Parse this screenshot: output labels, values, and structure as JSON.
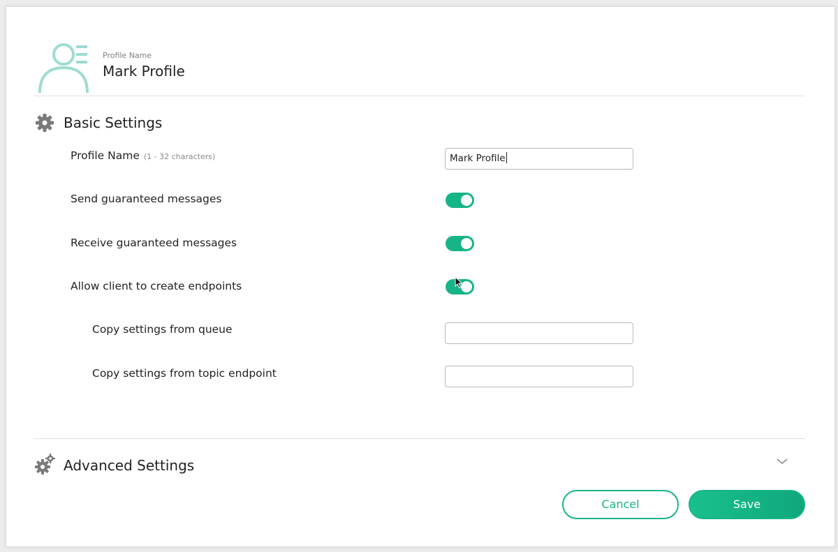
{
  "profile": {
    "caption": "Profile Name",
    "name": "Mark Profile"
  },
  "basic_settings": {
    "title": "Basic Settings",
    "rows": [
      {
        "label": "Profile Name",
        "hint": "(1 - 32 characters)",
        "value": "Mark Profile"
      },
      {
        "label": "Send guaranteed messages",
        "enabled": true
      },
      {
        "label": "Receive guaranteed messages",
        "enabled": true
      },
      {
        "label": "Allow client to create endpoints",
        "enabled": true
      },
      {
        "label": "Copy settings from queue",
        "value": ""
      },
      {
        "label": "Copy settings from topic endpoint",
        "value": ""
      }
    ]
  },
  "advanced_settings": {
    "title": "Advanced Settings",
    "icon": "chevron-down-icon"
  },
  "actions": {
    "cancel_label": "Cancel",
    "save_label": "Save"
  },
  "colors": {
    "accent": "#17b487",
    "avatar": "#9edcd0"
  }
}
